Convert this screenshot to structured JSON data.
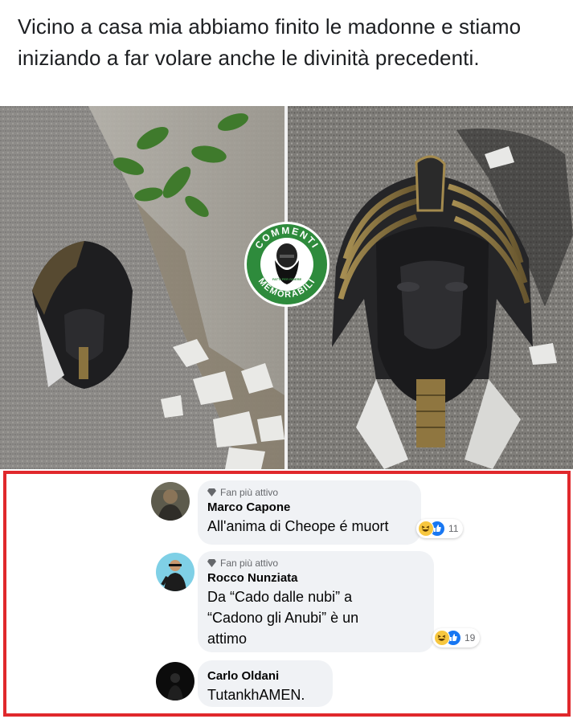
{
  "post": {
    "text": "Vicino a casa mia abbiamo finito le madonne e stiamo iniziando a far volare anche le divinità precedenti."
  },
  "watermark": {
    "top_text": "COMMENTI",
    "bottom_text": "MEMORABILI",
    "small_text": "FATTI PER RIDERE"
  },
  "comments": [
    {
      "badge": "Fan più attivo",
      "author": "Marco Capone",
      "text": "All'anima di Cheope é muort",
      "reaction_count": "11"
    },
    {
      "badge": "Fan più attivo",
      "author": "Rocco Nunziata",
      "text_lines": [
        "Da “Cado dalle nubi” a",
        "“Cadono gli Anubi” è un",
        "attimo"
      ],
      "reaction_count": "19"
    },
    {
      "author": "Carlo Oldani",
      "text": "TutankhAMEN."
    }
  ],
  "colors": {
    "highlight_border": "#e0282c",
    "badge_green": "#2e8b3c",
    "bubble_bg": "#f0f2f5",
    "like_blue": "#1877f2",
    "haha_yellow": "#f7c73f"
  },
  "icons": {
    "fan_badge": "diamond-icon",
    "reactions": [
      "haha-reaction-icon",
      "like-reaction-icon"
    ]
  }
}
